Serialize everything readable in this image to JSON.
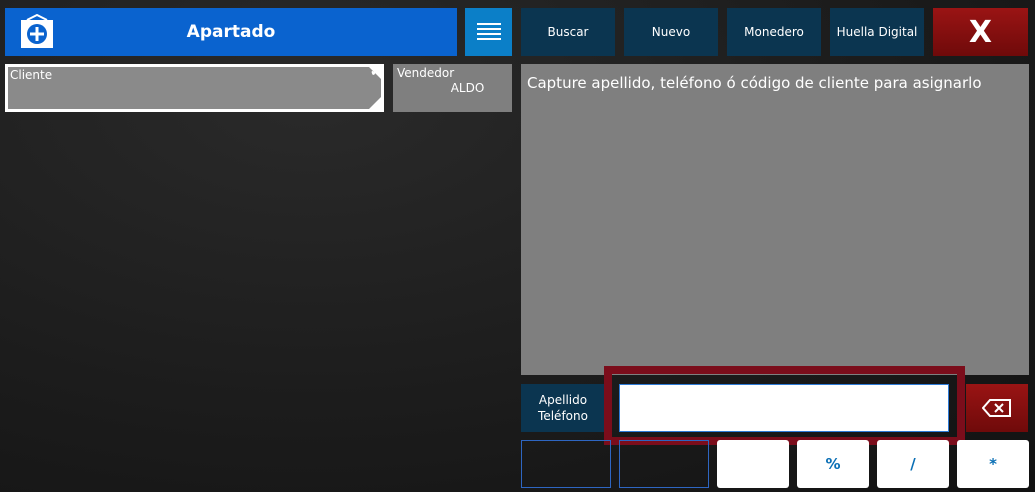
{
  "header": {
    "title": "Apartado",
    "buttons": {
      "buscar": "Buscar",
      "nuevo": "Nuevo",
      "monedero": "Monedero",
      "huella": "Huella Digital",
      "close": "X"
    }
  },
  "cliente": {
    "label": "Cliente",
    "check": "✔"
  },
  "vendedor": {
    "label": "Vendedor",
    "value": "ALDO"
  },
  "message": "Capture apellido, teléfono ó código de cliente para asignarlo",
  "input": {
    "label_line1": "Apellido",
    "label_line2": "Teléfono",
    "value": ""
  },
  "keypad": {
    "blank": "",
    "percent": "%",
    "slash": "/",
    "star": "*"
  },
  "colors": {
    "primary_blue": "#0a63cf",
    "dark_teal": "#0b3550",
    "close_red": "#8a1010",
    "highlight_frame": "#7b0d1b",
    "panel_gray": "#7f7f7f"
  }
}
